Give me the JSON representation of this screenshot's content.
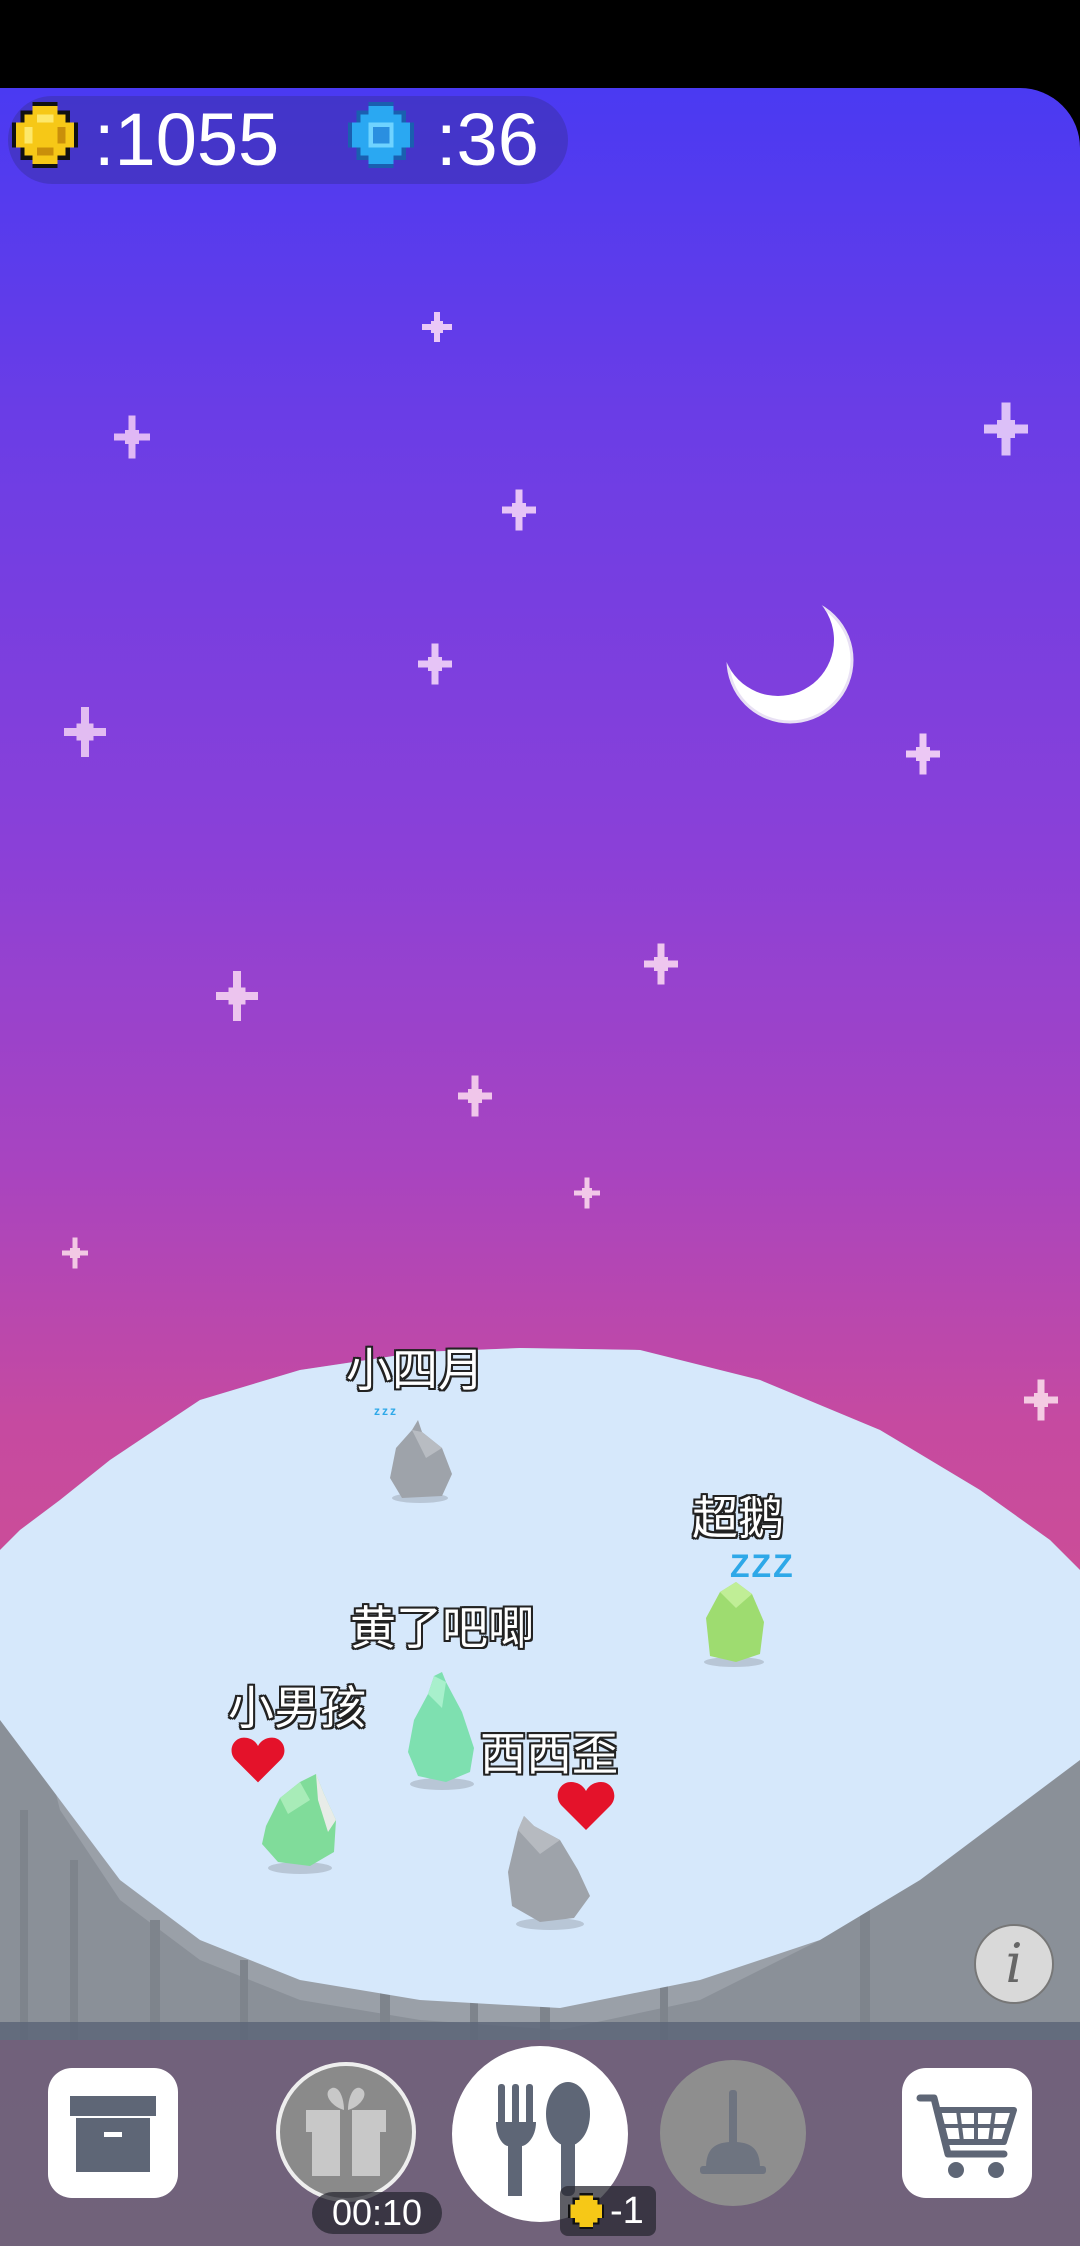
{
  "hud": {
    "coins": ":1055",
    "gems": ":36",
    "coin_icon": "gold-coin-icon",
    "gem_icon": "blue-gem-icon"
  },
  "pets": [
    {
      "name": "小四月",
      "state": "zzz"
    },
    {
      "name": "超鹅",
      "state": "ZZZ"
    },
    {
      "name": "黄了吧唧"
    },
    {
      "name": "小男孩",
      "state": "heart"
    },
    {
      "name": "西西歪",
      "state": "heart"
    }
  ],
  "toolbar": {
    "storage_icon": "archive-box-icon",
    "gift_icon": "gift-icon",
    "gift_timer": "00:10",
    "feed_icon": "fork-spoon-icon",
    "feed_cost": "-1",
    "clean_icon": "plunger-icon",
    "shop_icon": "shopping-cart-icon"
  },
  "info_label": "i",
  "colors": {
    "sky_top": "#4a3af2",
    "sky_bottom": "#d85a88",
    "ice": "#d6e8fb",
    "toolbar": "#5a6478"
  }
}
